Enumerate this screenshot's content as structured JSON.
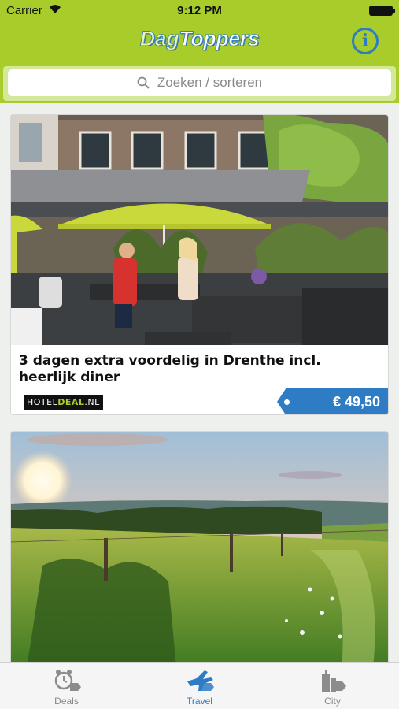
{
  "status_bar": {
    "carrier": "Carrier",
    "time": "9:12 PM"
  },
  "header": {
    "logo_part1": "Dag",
    "logo_part2": "Toppers",
    "info_icon": "info-icon"
  },
  "search": {
    "placeholder": "Zoeken / sorteren",
    "icon": "search-icon"
  },
  "deals": [
    {
      "title": "3 dagen extra voordelig in Drenthe incl. heerlijk diner",
      "partner_prefix": "HOTEL",
      "partner_highlight": "DEAL",
      "partner_suffix": ".NL",
      "price": "€ 49,50"
    },
    {
      "title": ""
    }
  ],
  "tabs": [
    {
      "label": "Deals",
      "icon": "alarm-clock-tag-icon"
    },
    {
      "label": "Travel",
      "icon": "airplane-icon",
      "active": true
    },
    {
      "label": "City",
      "icon": "city-tag-icon"
    }
  ],
  "colors": {
    "brand_green": "#a8cc2a",
    "brand_blue": "#2e7cc4"
  }
}
